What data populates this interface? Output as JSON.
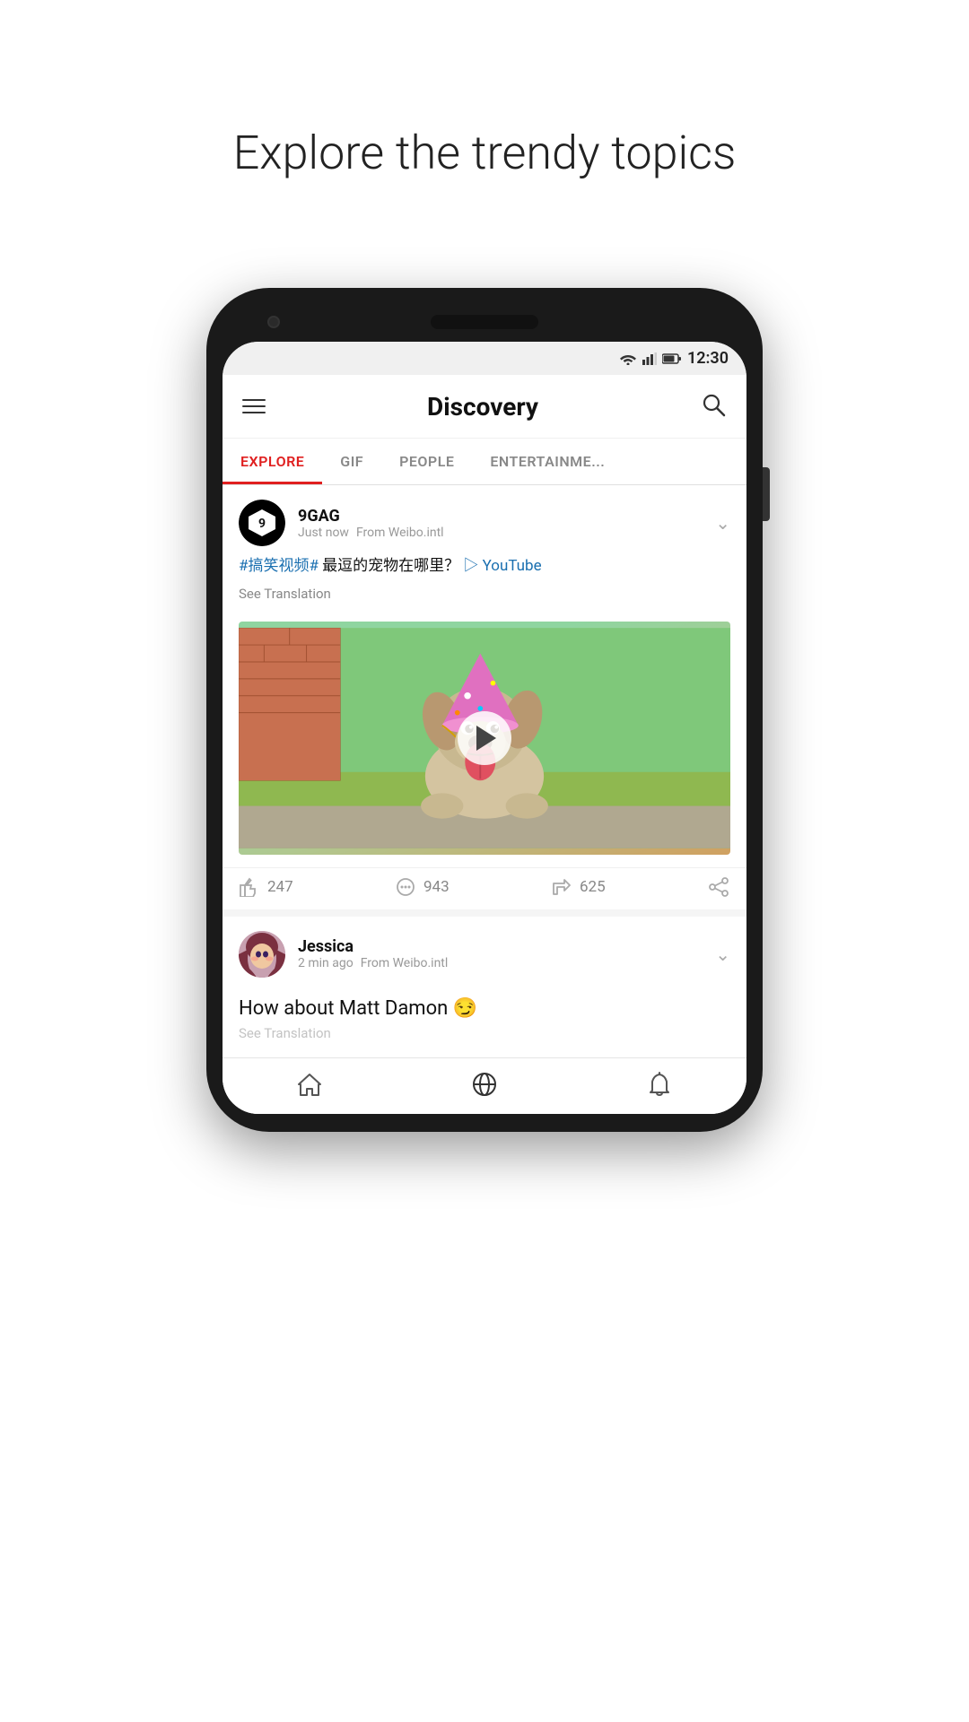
{
  "page": {
    "title": "Explore the trendy topics"
  },
  "status_bar": {
    "time": "12:30"
  },
  "header": {
    "title": "Discovery",
    "hamburger_label": "Menu",
    "search_label": "Search"
  },
  "tabs": [
    {
      "id": "explore",
      "label": "EXPLORE",
      "active": true
    },
    {
      "id": "gif",
      "label": "GIF",
      "active": false
    },
    {
      "id": "people",
      "label": "PEOPLE",
      "active": false
    },
    {
      "id": "entertainment",
      "label": "ENTERTAINME...",
      "active": false
    }
  ],
  "posts": [
    {
      "id": "post1",
      "author": {
        "name": "9GAG",
        "avatar_type": "9gag"
      },
      "timestamp": "Just now",
      "source": "From Weibo.intl",
      "text_parts": [
        {
          "type": "hashtag",
          "text": "#搞笑视频#"
        },
        {
          "type": "normal",
          "text": " 最逗的宠物在哪里？"
        },
        {
          "type": "link",
          "text": "▷ YouTube"
        }
      ],
      "see_translation": "See Translation",
      "has_video": true,
      "likes": "247",
      "comments": "943",
      "reposts": "625"
    },
    {
      "id": "post2",
      "author": {
        "name": "Jessica",
        "avatar_type": "jessica"
      },
      "timestamp": "2 min ago",
      "source": "From Weibo.intl",
      "text": "How about Matt Damon 😏",
      "see_translation": "See Translation"
    }
  ],
  "bottom_nav": [
    {
      "id": "home",
      "icon": "home",
      "label": "Home"
    },
    {
      "id": "discover",
      "icon": "discover",
      "label": "Discover"
    },
    {
      "id": "notifications",
      "icon": "bell",
      "label": "Notifications"
    }
  ]
}
